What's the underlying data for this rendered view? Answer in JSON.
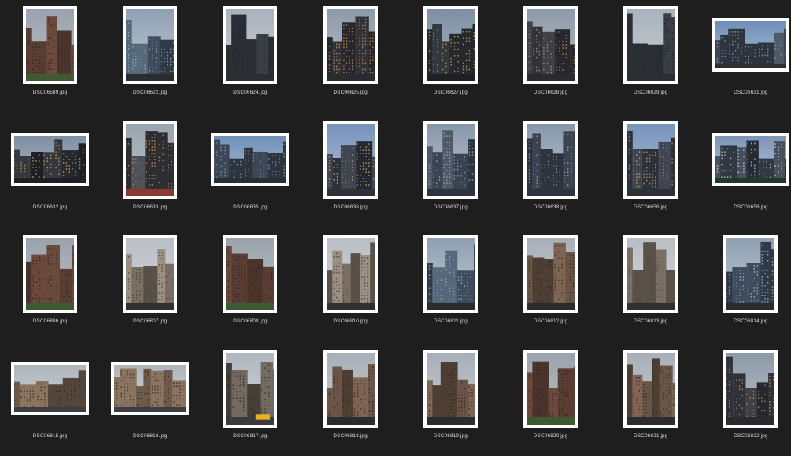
{
  "window": {
    "view": "icon-grid"
  },
  "files": [
    {
      "name": "DSC06589.jpg",
      "orientation": "portrait",
      "scene": "brick-facade"
    },
    {
      "name": "DSC06622.jpg",
      "orientation": "portrait",
      "scene": "glass-towers"
    },
    {
      "name": "DSC06624.jpg",
      "orientation": "portrait",
      "scene": "foggy-street"
    },
    {
      "name": "DSC06625.jpg",
      "orientation": "portrait",
      "scene": "street-canyon"
    },
    {
      "name": "DSC06627.jpg",
      "orientation": "portrait",
      "scene": "dark-towers"
    },
    {
      "name": "DSC06628.jpg",
      "orientation": "portrait",
      "scene": "street-canyon"
    },
    {
      "name": "DSC06629.jpg",
      "orientation": "portrait",
      "scene": "foggy-street"
    },
    {
      "name": "DSC06631.jpg",
      "orientation": "landscape",
      "scene": "sky-towers"
    },
    {
      "name": "DSC06632.jpg",
      "orientation": "landscape",
      "scene": "dark-towers"
    },
    {
      "name": "DSC06633.jpg",
      "orientation": "portrait",
      "scene": "wet-street"
    },
    {
      "name": "DSC06635.jpg",
      "orientation": "landscape",
      "scene": "sky-towers"
    },
    {
      "name": "DSC06636.jpg",
      "orientation": "portrait",
      "scene": "looking-up"
    },
    {
      "name": "DSC06637.jpg",
      "orientation": "portrait",
      "scene": "foggy-tower"
    },
    {
      "name": "DSC06638.jpg",
      "orientation": "portrait",
      "scene": "foggy-tower"
    },
    {
      "name": "DSC06656.jpg",
      "orientation": "portrait",
      "scene": "looking-up"
    },
    {
      "name": "DSC06658.jpg",
      "orientation": "landscape",
      "scene": "skyline"
    },
    {
      "name": "DSC06806.jpg",
      "orientation": "portrait",
      "scene": "brick-facade"
    },
    {
      "name": "DSC06807.jpg",
      "orientation": "portrait",
      "scene": "pale-tower"
    },
    {
      "name": "DSC06808.jpg",
      "orientation": "portrait",
      "scene": "brick-facade"
    },
    {
      "name": "DSC06810.jpg",
      "orientation": "portrait",
      "scene": "pale-tower"
    },
    {
      "name": "DSC06811.jpg",
      "orientation": "portrait",
      "scene": "glass-towers"
    },
    {
      "name": "DSC06812.jpg",
      "orientation": "portrait",
      "scene": "brown-towers"
    },
    {
      "name": "DSC06813.jpg",
      "orientation": "portrait",
      "scene": "pale-tower"
    },
    {
      "name": "DSC06814.jpg",
      "orientation": "portrait",
      "scene": "glass-towers"
    },
    {
      "name": "DSC06815.jpg",
      "orientation": "landscape",
      "scene": "low-facade"
    },
    {
      "name": "DSC06816.jpg",
      "orientation": "landscape",
      "scene": "low-facade"
    },
    {
      "name": "DSC06817.jpg",
      "orientation": "portrait",
      "scene": "street-taxi"
    },
    {
      "name": "DSC06818.jpg",
      "orientation": "portrait",
      "scene": "brown-towers"
    },
    {
      "name": "DSC06819.jpg",
      "orientation": "portrait",
      "scene": "brown-towers"
    },
    {
      "name": "DSC06820.jpg",
      "orientation": "portrait",
      "scene": "brick-facade"
    },
    {
      "name": "DSC06821.jpg",
      "orientation": "portrait",
      "scene": "brown-towers"
    },
    {
      "name": "DSC06822.jpg",
      "orientation": "portrait",
      "scene": "street-canyon"
    }
  ],
  "colors": {
    "background": "#1e1e1e",
    "thumb_border": "#ffffff",
    "label_text": "#d6d6d6"
  }
}
